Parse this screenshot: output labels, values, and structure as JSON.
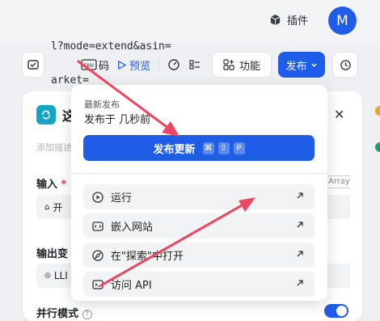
{
  "topbar": {
    "plugin_label": "插件",
    "avatar_letter": "M"
  },
  "url_fragments": [
    "l?mode=extend&asin=",
    "arket="
  ],
  "toolbar": {
    "code_label": "码",
    "preview_label": "预览",
    "function_label": "功能",
    "publish_label": "发布"
  },
  "node": {
    "title": "这",
    "description": "添加描述",
    "input_label": "输入",
    "input_required": "*",
    "input_value": "开",
    "array_tag": "Array",
    "output_label": "输出变",
    "output_value": "LLI",
    "parallel_label": "并行模式",
    "help_glyph": "?"
  },
  "popup": {
    "latest_title": "最新发布",
    "published_time": "发布于 几秒前",
    "publish_update_label": "发布更新",
    "shortcut_keys": [
      "⌘",
      "⇧",
      "P"
    ],
    "menu_items": [
      {
        "label": "运行",
        "icon": "play-circle-icon"
      },
      {
        "label": "嵌入网站",
        "icon": "embed-code-icon"
      },
      {
        "label": "在\"探索\"中打开",
        "icon": "compass-icon"
      },
      {
        "label": "访问 API",
        "icon": "terminal-icon"
      }
    ]
  },
  "colors": {
    "accent": "#1f5de8",
    "annotation_arrow": "#f0455f",
    "node_icon": "#16a3c4"
  }
}
